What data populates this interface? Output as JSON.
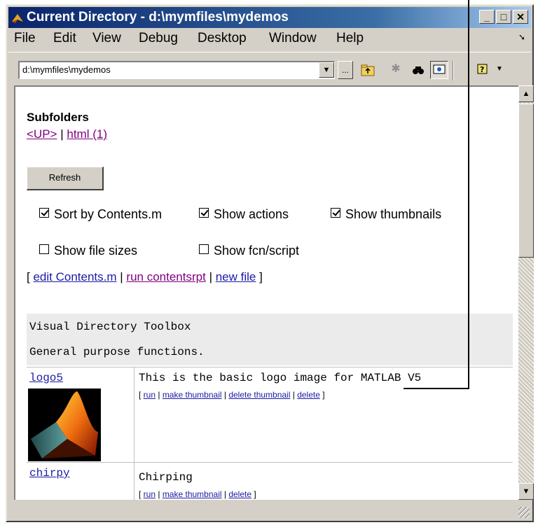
{
  "window": {
    "title": "Current Directory - d:\\mymfiles\\mydemos",
    "buttons": {
      "minimize": "_",
      "maximize": "□",
      "close": "✕"
    }
  },
  "menu": {
    "items": [
      {
        "label": "File"
      },
      {
        "label": "Edit"
      },
      {
        "label": "View"
      },
      {
        "label": "Debug"
      },
      {
        "label": "Desktop"
      },
      {
        "label": "Window"
      },
      {
        "label": "Help"
      }
    ]
  },
  "toolbar": {
    "path_value": "d:\\mymfiles\\mydemos",
    "browse_label": "...",
    "icons": [
      "up-folder-icon",
      "new-folder-icon",
      "find-icon",
      "view-toggle-icon",
      "help-icon"
    ]
  },
  "subfolders": {
    "heading": "Subfolders",
    "up_link": "<UP>",
    "separator": "|",
    "html_link": "html (1)"
  },
  "refresh_button": "Refresh",
  "options": {
    "sort_by_contents": {
      "label": "Sort by Contents.m",
      "checked": true
    },
    "show_actions": {
      "label": "Show actions",
      "checked": true
    },
    "show_thumbnails": {
      "label": "Show thumbnails",
      "checked": true
    },
    "show_file_sizes": {
      "label": "Show file sizes",
      "checked": false
    },
    "show_fcn_script": {
      "label": "Show fcn/script",
      "checked": false
    }
  },
  "content_links": {
    "open": "[",
    "edit": "edit Contents.m",
    "sep1": "|",
    "run": "run contentsrpt",
    "sep2": "|",
    "new_file": "new file",
    "close": "]"
  },
  "toolbox": {
    "title": "Visual Directory Toolbox",
    "description": "General purpose functions."
  },
  "files": [
    {
      "name": "logo5",
      "description": "This is the basic logo image for MATLAB V5",
      "actions": [
        "run",
        "make thumbnail",
        "delete thumbnail",
        "delete"
      ]
    },
    {
      "name": "chirpy",
      "description": "Chirping",
      "actions": [
        "run",
        "make thumbnail",
        "delete"
      ]
    }
  ]
}
